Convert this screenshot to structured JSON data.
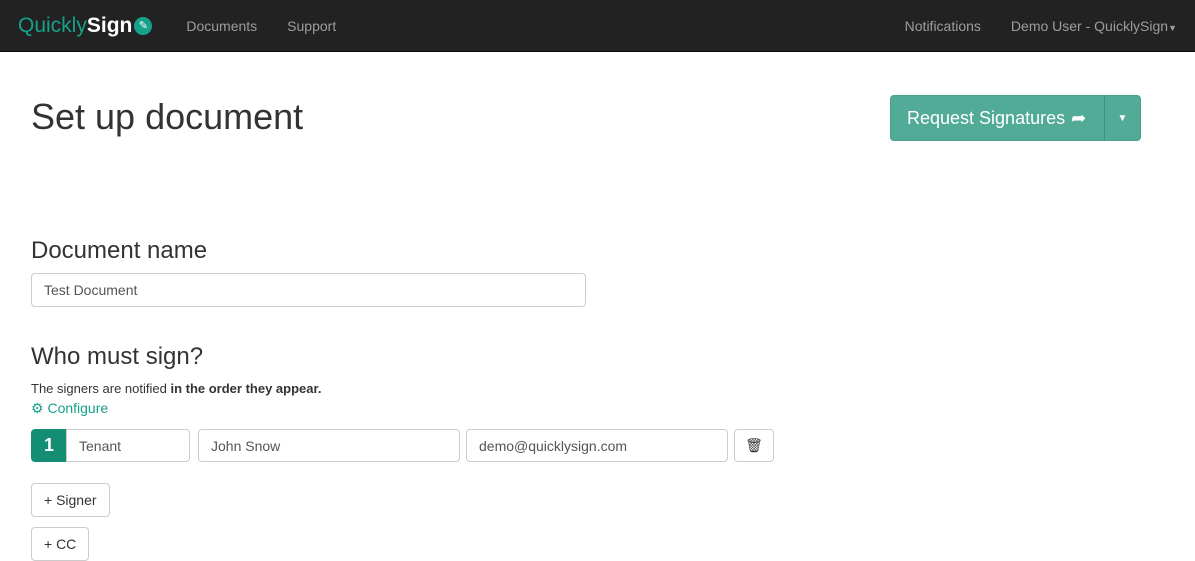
{
  "nav": {
    "logo_a": "Quickly",
    "logo_b": "Sign",
    "items": [
      "Documents",
      "Support"
    ],
    "notifications": "Notifications",
    "user": "Demo User - QuicklySign"
  },
  "page": {
    "title": "Set up document",
    "request_button": "Request Signatures"
  },
  "document": {
    "heading": "Document name",
    "name_value": "Test Document"
  },
  "signers": {
    "heading": "Who must sign?",
    "note_plain": "The signers are notified ",
    "note_bold": "in the order they appear.",
    "configure": "Configure",
    "rows": [
      {
        "order": "1",
        "role": "Tenant",
        "name": "John Snow",
        "email": "demo@quicklysign.com"
      }
    ],
    "add_signer": "+ Signer",
    "add_cc": "+ CC"
  }
}
